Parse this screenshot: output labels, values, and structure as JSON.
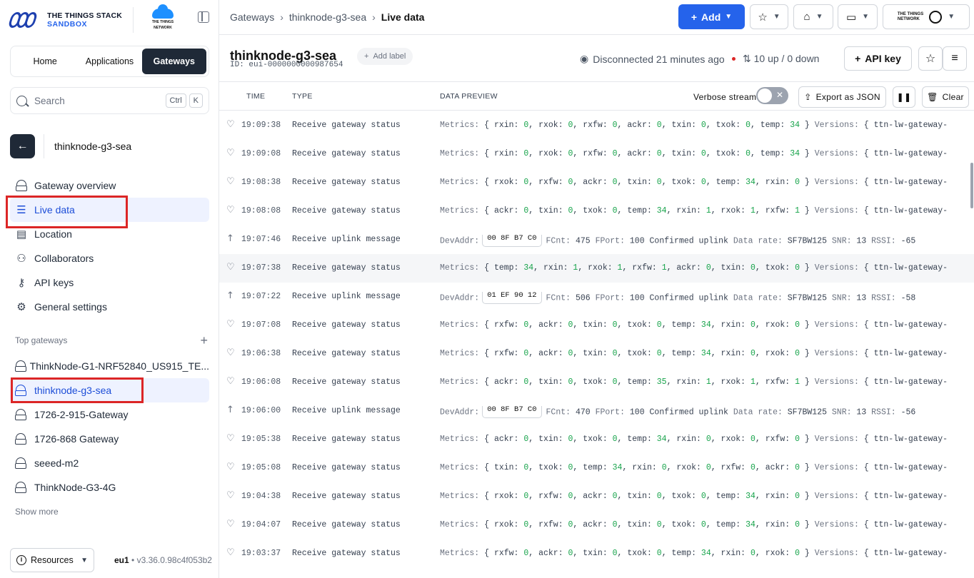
{
  "brand": {
    "line1": "THE THINGS STACK",
    "line2": "SANDBOX",
    "partner_line1": "THE THINGS",
    "partner_line2": "NETWORK"
  },
  "tabs": [
    {
      "label": "Home"
    },
    {
      "label": "Applications"
    },
    {
      "label": "Gateways"
    }
  ],
  "search": {
    "placeholder": "Search",
    "key1": "Ctrl",
    "key2": "K"
  },
  "context": {
    "title": "thinknode-g3-sea"
  },
  "nav": [
    {
      "label": "Gateway overview",
      "icon": "gateway-icon"
    },
    {
      "label": "Live data",
      "icon": "list-icon"
    },
    {
      "label": "Location",
      "icon": "map-icon"
    },
    {
      "label": "Collaborators",
      "icon": "users-icon"
    },
    {
      "label": "API keys",
      "icon": "key-icon"
    },
    {
      "label": "General settings",
      "icon": "gear-icon"
    }
  ],
  "top_gateways": {
    "heading": "Top gateways",
    "items": [
      {
        "label": "ThinkNode-G1-NRF52840_US915_TE..."
      },
      {
        "label": "thinknode-g3-sea"
      },
      {
        "label": "1726-2-915-Gateway"
      },
      {
        "label": "1726-868 Gateway"
      },
      {
        "label": "seeed-m2"
      },
      {
        "label": "ThinkNode-G3-4G"
      }
    ],
    "show_more": "Show more"
  },
  "footer": {
    "resources": "Resources",
    "cluster": "eu1",
    "version": "v3.36.0.98c4f053b2"
  },
  "breadcrumb": {
    "item1": "Gateways",
    "item2": "thinknode-g3-sea",
    "current": "Live data"
  },
  "topbar": {
    "add_label": "Add",
    "partner_line1": "THE THINGS",
    "partner_line2": "NETWORK"
  },
  "gateway": {
    "name": "thinknode-g3-sea",
    "id_label": "ID: eui-0000000000987654",
    "add_label": "Add label",
    "status": "Disconnected 21 minutes ago",
    "traffic": "10 up / 0 down",
    "api_key_label": "API key"
  },
  "table": {
    "col_time": "TIME",
    "col_type": "TYPE",
    "col_preview": "DATA PREVIEW",
    "verbose_label": "Verbose stream",
    "export_label": "Export as JSON",
    "clear_label": "Clear",
    "verbose_on": false
  },
  "events": [
    {
      "time": "19:09:38",
      "type": "Receive gateway status",
      "kind": "status",
      "metrics": [
        [
          "rxin",
          "0"
        ],
        [
          "rxok",
          "0"
        ],
        [
          "rxfw",
          "0"
        ],
        [
          "ackr",
          "0"
        ],
        [
          "txin",
          "0"
        ],
        [
          "txok",
          "0"
        ],
        [
          "temp",
          "34"
        ]
      ]
    },
    {
      "time": "19:09:08",
      "type": "Receive gateway status",
      "kind": "status",
      "metrics": [
        [
          "rxin",
          "0"
        ],
        [
          "rxok",
          "0"
        ],
        [
          "rxfw",
          "0"
        ],
        [
          "ackr",
          "0"
        ],
        [
          "txin",
          "0"
        ],
        [
          "txok",
          "0"
        ],
        [
          "temp",
          "34"
        ]
      ]
    },
    {
      "time": "19:08:38",
      "type": "Receive gateway status",
      "kind": "status",
      "metrics": [
        [
          "rxok",
          "0"
        ],
        [
          "rxfw",
          "0"
        ],
        [
          "ackr",
          "0"
        ],
        [
          "txin",
          "0"
        ],
        [
          "txok",
          "0"
        ],
        [
          "temp",
          "34"
        ],
        [
          "rxin",
          "0"
        ]
      ]
    },
    {
      "time": "19:08:08",
      "type": "Receive gateway status",
      "kind": "status",
      "metrics": [
        [
          "ackr",
          "0"
        ],
        [
          "txin",
          "0"
        ],
        [
          "txok",
          "0"
        ],
        [
          "temp",
          "34"
        ],
        [
          "rxin",
          "1"
        ],
        [
          "rxok",
          "1"
        ],
        [
          "rxfw",
          "1"
        ]
      ]
    },
    {
      "time": "19:07:46",
      "type": "Receive uplink message",
      "kind": "uplink",
      "devaddr": "00 8F B7 C0",
      "fcnt": "475",
      "fport": "100",
      "confirmed": "Confirmed uplink",
      "rate": "SF7BW125",
      "snr": "13",
      "rssi": "-65"
    },
    {
      "time": "19:07:38",
      "type": "Receive gateway status",
      "kind": "status",
      "metrics": [
        [
          "temp",
          "34"
        ],
        [
          "rxin",
          "1"
        ],
        [
          "rxok",
          "1"
        ],
        [
          "rxfw",
          "1"
        ],
        [
          "ackr",
          "0"
        ],
        [
          "txin",
          "0"
        ],
        [
          "txok",
          "0"
        ]
      ]
    },
    {
      "time": "19:07:22",
      "type": "Receive uplink message",
      "kind": "uplink",
      "devaddr": "01 EF 90 12",
      "fcnt": "506",
      "fport": "100",
      "confirmed": "Confirmed uplink",
      "rate": "SF7BW125",
      "snr": "13",
      "rssi": "-58"
    },
    {
      "time": "19:07:08",
      "type": "Receive gateway status",
      "kind": "status",
      "metrics": [
        [
          "rxfw",
          "0"
        ],
        [
          "ackr",
          "0"
        ],
        [
          "txin",
          "0"
        ],
        [
          "txok",
          "0"
        ],
        [
          "temp",
          "34"
        ],
        [
          "rxin",
          "0"
        ],
        [
          "rxok",
          "0"
        ]
      ]
    },
    {
      "time": "19:06:38",
      "type": "Receive gateway status",
      "kind": "status",
      "metrics": [
        [
          "rxfw",
          "0"
        ],
        [
          "ackr",
          "0"
        ],
        [
          "txin",
          "0"
        ],
        [
          "txok",
          "0"
        ],
        [
          "temp",
          "34"
        ],
        [
          "rxin",
          "0"
        ],
        [
          "rxok",
          "0"
        ]
      ]
    },
    {
      "time": "19:06:08",
      "type": "Receive gateway status",
      "kind": "status",
      "metrics": [
        [
          "ackr",
          "0"
        ],
        [
          "txin",
          "0"
        ],
        [
          "txok",
          "0"
        ],
        [
          "temp",
          "35"
        ],
        [
          "rxin",
          "1"
        ],
        [
          "rxok",
          "1"
        ],
        [
          "rxfw",
          "1"
        ]
      ]
    },
    {
      "time": "19:06:00",
      "type": "Receive uplink message",
      "kind": "uplink",
      "devaddr": "00 8F B7 C0",
      "fcnt": "470",
      "fport": "100",
      "confirmed": "Confirmed uplink",
      "rate": "SF7BW125",
      "snr": "13",
      "rssi": "-56"
    },
    {
      "time": "19:05:38",
      "type": "Receive gateway status",
      "kind": "status",
      "metrics": [
        [
          "ackr",
          "0"
        ],
        [
          "txin",
          "0"
        ],
        [
          "txok",
          "0"
        ],
        [
          "temp",
          "34"
        ],
        [
          "rxin",
          "0"
        ],
        [
          "rxok",
          "0"
        ],
        [
          "rxfw",
          "0"
        ]
      ]
    },
    {
      "time": "19:05:08",
      "type": "Receive gateway status",
      "kind": "status",
      "metrics": [
        [
          "txin",
          "0"
        ],
        [
          "txok",
          "0"
        ],
        [
          "temp",
          "34"
        ],
        [
          "rxin",
          "0"
        ],
        [
          "rxok",
          "0"
        ],
        [
          "rxfw",
          "0"
        ],
        [
          "ackr",
          "0"
        ]
      ]
    },
    {
      "time": "19:04:38",
      "type": "Receive gateway status",
      "kind": "status",
      "metrics": [
        [
          "rxok",
          "0"
        ],
        [
          "rxfw",
          "0"
        ],
        [
          "ackr",
          "0"
        ],
        [
          "txin",
          "0"
        ],
        [
          "txok",
          "0"
        ],
        [
          "temp",
          "34"
        ],
        [
          "rxin",
          "0"
        ]
      ]
    },
    {
      "time": "19:04:07",
      "type": "Receive gateway status",
      "kind": "status",
      "metrics": [
        [
          "rxok",
          "0"
        ],
        [
          "rxfw",
          "0"
        ],
        [
          "ackr",
          "0"
        ],
        [
          "txin",
          "0"
        ],
        [
          "txok",
          "0"
        ],
        [
          "temp",
          "34"
        ],
        [
          "rxin",
          "0"
        ]
      ]
    },
    {
      "time": "19:03:37",
      "type": "Receive gateway status",
      "kind": "status",
      "metrics": [
        [
          "rxfw",
          "0"
        ],
        [
          "ackr",
          "0"
        ],
        [
          "txin",
          "0"
        ],
        [
          "txok",
          "0"
        ],
        [
          "temp",
          "34"
        ],
        [
          "rxin",
          "0"
        ],
        [
          "rxok",
          "0"
        ]
      ]
    }
  ],
  "preview_labels": {
    "metrics": "Metrics:",
    "versions": "Versions:",
    "versions_value": "{ ttn-lw-gateway-",
    "devaddr": "DevAddr:",
    "fcnt": "FCnt:",
    "fport": "FPort:",
    "rate": "Data rate:",
    "snr": "SNR:",
    "rssi": "RSSI:"
  },
  "colors": {
    "accent": "#2563eb",
    "highlight": "#dc2626",
    "number": "#16a34a",
    "dark": "#1f2937"
  }
}
